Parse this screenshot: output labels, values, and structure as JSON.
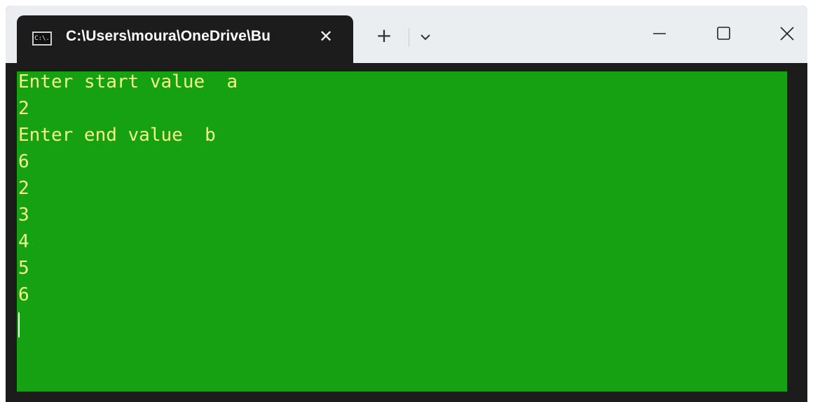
{
  "tab": {
    "icon_text": "C:\\.",
    "title": "C:\\Users\\moura\\OneDrive\\Bu",
    "close_glyph": "✕"
  },
  "toolbar": {
    "new_tab_glyph": "+",
    "dropdown_icon": "chevron-down-icon"
  },
  "window_controls": {
    "minimize_icon": "minimize-icon",
    "maximize_icon": "maximize-icon",
    "close_icon": "close-icon"
  },
  "terminal": {
    "background_color": "#16a112",
    "text_color": "#f2f58a",
    "lines": [
      "Enter start value  a",
      "2",
      "Enter end value  b",
      "6",
      "2",
      "3",
      "4",
      "5",
      "6"
    ]
  }
}
